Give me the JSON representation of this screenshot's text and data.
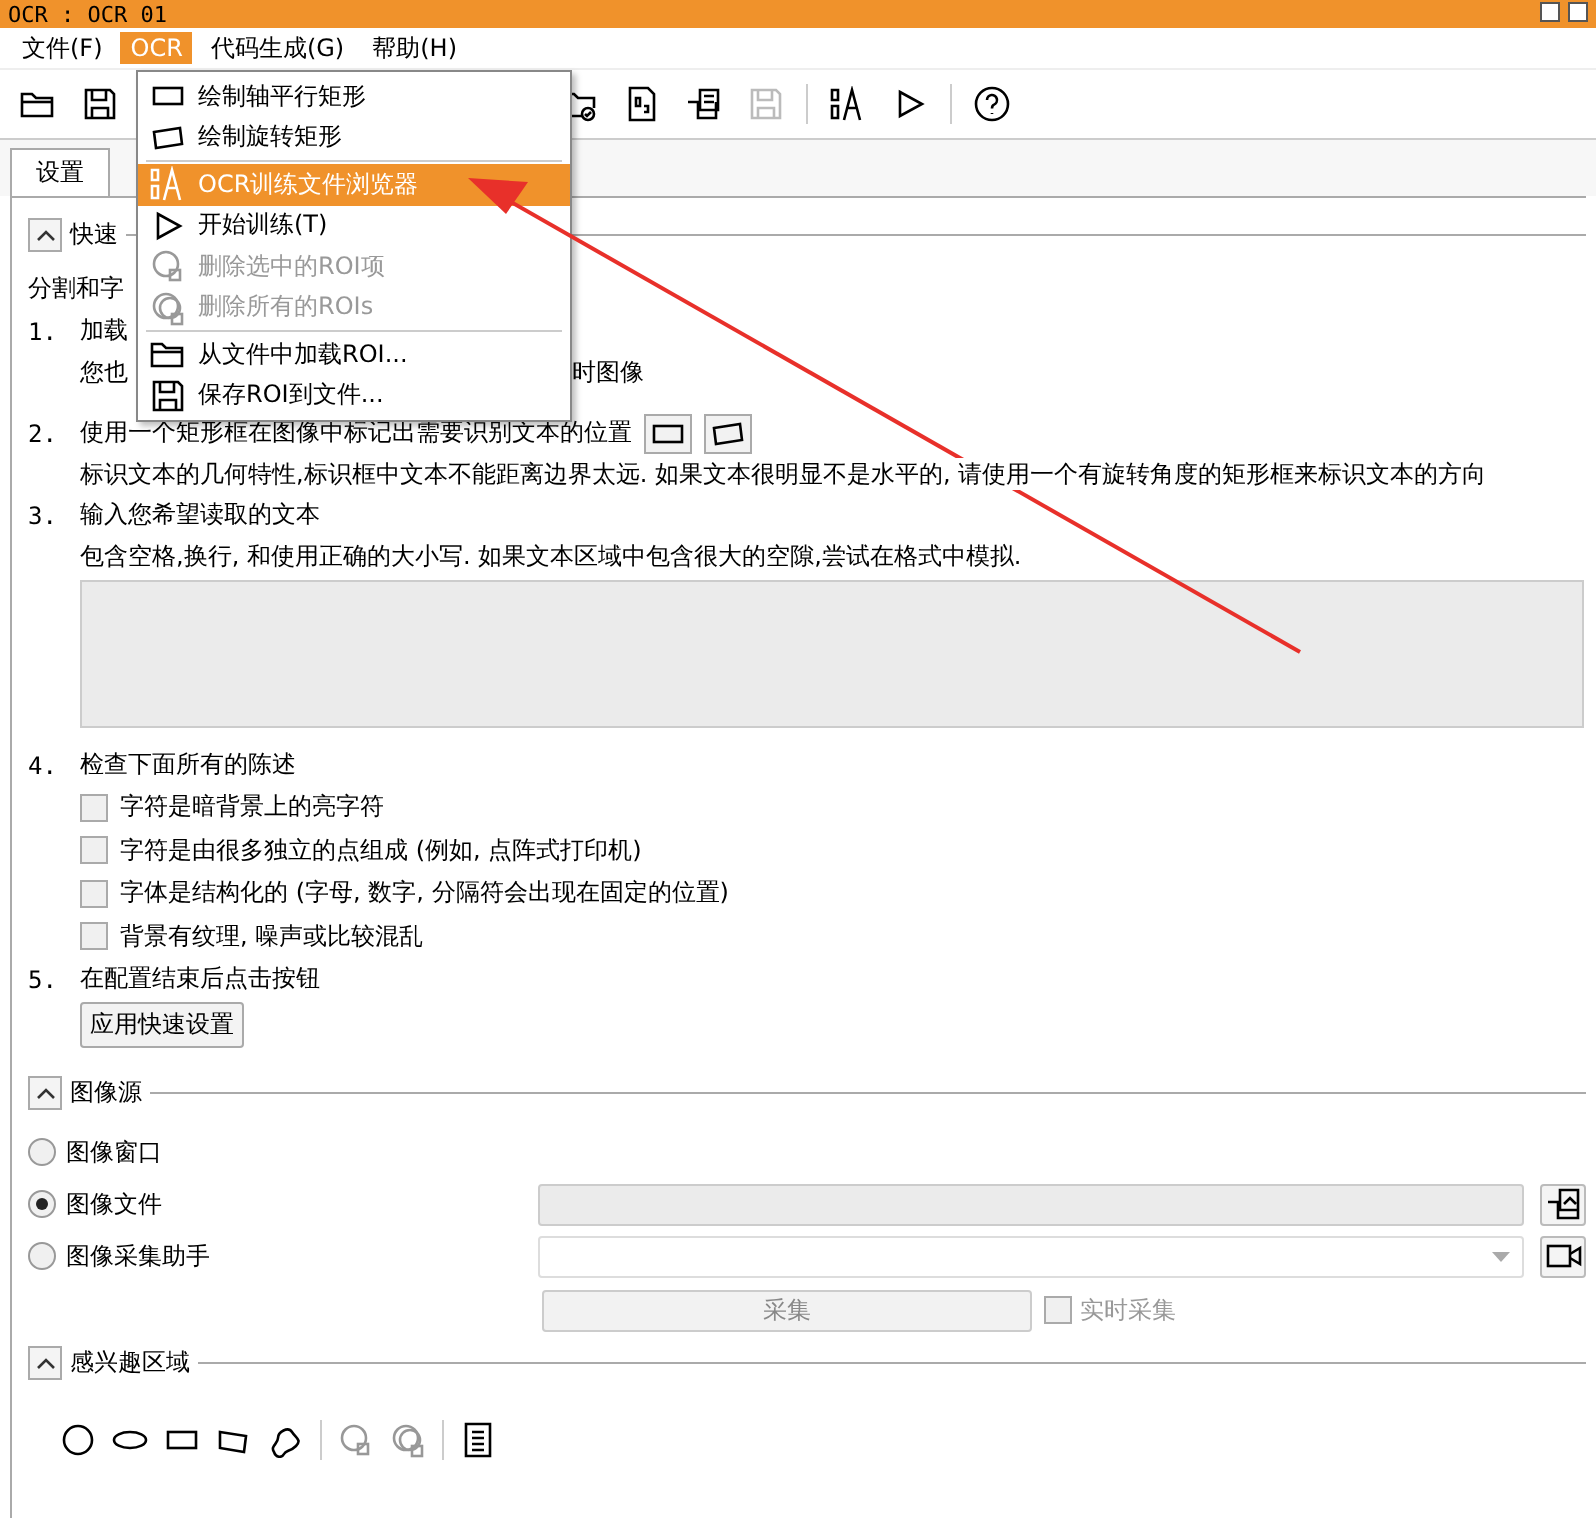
{
  "window": {
    "title": "OCR : OCR 01"
  },
  "menubar": [
    {
      "label": "文件(F)",
      "selected": false
    },
    {
      "label": "OCR",
      "selected": true
    },
    {
      "label": "代码生成(G)",
      "selected": false
    },
    {
      "label": "帮助(H)",
      "selected": false
    }
  ],
  "toolbar": {
    "buttons": [
      {
        "kind": "open",
        "disabled": false
      },
      {
        "kind": "save",
        "disabled": false
      },
      {
        "kind": "gap"
      },
      {
        "kind": "folder-check",
        "disabled": false
      },
      {
        "kind": "doc",
        "disabled": false
      },
      {
        "kind": "folder-doc",
        "disabled": false
      },
      {
        "kind": "save",
        "disabled": true
      },
      {
        "kind": "sep"
      },
      {
        "kind": "font",
        "disabled": false
      },
      {
        "kind": "play",
        "disabled": false
      },
      {
        "kind": "sep"
      },
      {
        "kind": "help",
        "disabled": false
      }
    ]
  },
  "tabs": [
    {
      "label": "设置",
      "selected": true
    }
  ],
  "ocr_menu": [
    {
      "kind": "item",
      "label": "绘制轴平行矩形",
      "disabled": false,
      "selected": false
    },
    {
      "kind": "item",
      "label": "绘制旋转矩形",
      "disabled": false,
      "selected": false
    },
    {
      "kind": "separator"
    },
    {
      "kind": "item",
      "label": "OCR训练文件浏览器",
      "disabled": false,
      "selected": true
    },
    {
      "kind": "item",
      "label": "开始训练(T)",
      "disabled": false,
      "selected": false
    },
    {
      "kind": "item",
      "label": "删除选中的ROI项",
      "disabled": true,
      "selected": false
    },
    {
      "kind": "item",
      "label": "删除所有的ROIs",
      "disabled": true,
      "selected": false
    },
    {
      "kind": "separator"
    },
    {
      "kind": "item",
      "label": "从文件中加载ROI...",
      "disabled": false,
      "selected": false
    },
    {
      "kind": "item",
      "label": "保存ROI到文件...",
      "disabled": false,
      "selected": false
    }
  ],
  "quick_setup": {
    "title": "快速",
    "expanded": true,
    "intro": "分割和字",
    "steps": [
      {
        "number": "1.",
        "lines": [
          "加载"
        ],
        "sub": "您也",
        "sub_tail": "时图像"
      },
      {
        "number": "2.",
        "lines": [
          "使用一个矩形框在图像中标记出需要识别文本的位置"
        ],
        "shape_buttons": true,
        "sub": "标识文本的几何特性,标识框中文本不能距离边界太远. 如果文本很明显不是水平的, 请使用一个有旋转角度的矩形框来标识文本的方向"
      },
      {
        "number": "3.",
        "lines": [
          "输入您希望读取的文本"
        ],
        "sub": "包含空格,换行, 和使用正确的大小写. 如果文本区域中包含很大的空隙,尝试在格式中模拟.",
        "textarea": true
      },
      {
        "number": "4.",
        "lines": [
          "检查下面所有的陈述"
        ],
        "checks": [
          {
            "label": "字符是暗背景上的亮字符",
            "checked": false
          },
          {
            "label": "字符是由很多独立的点组成 (例如, 点阵式打印机)",
            "checked": false
          },
          {
            "label": "字体是结构化的 (字母, 数字, 分隔符会出现在固定的位置)",
            "checked": false
          },
          {
            "label": "背景有纹理, 噪声或比较混乱",
            "checked": false
          }
        ]
      },
      {
        "number": "5.",
        "lines": [
          "在配置结束后点击按钮"
        ],
        "button": "应用快速设置"
      }
    ]
  },
  "image_source": {
    "title": "图像源",
    "expanded": true,
    "options": [
      {
        "label": "图像窗口",
        "selected": false,
        "kind": "none"
      },
      {
        "label": "图像文件",
        "selected": true,
        "kind": "file"
      },
      {
        "label": "图像采集助手",
        "selected": false,
        "kind": "combo"
      }
    ],
    "grab_button": "采集",
    "live": {
      "label": "实时采集",
      "checked": false,
      "disabled": true
    }
  },
  "roi": {
    "title": "感兴趣区域",
    "expanded": true
  }
}
